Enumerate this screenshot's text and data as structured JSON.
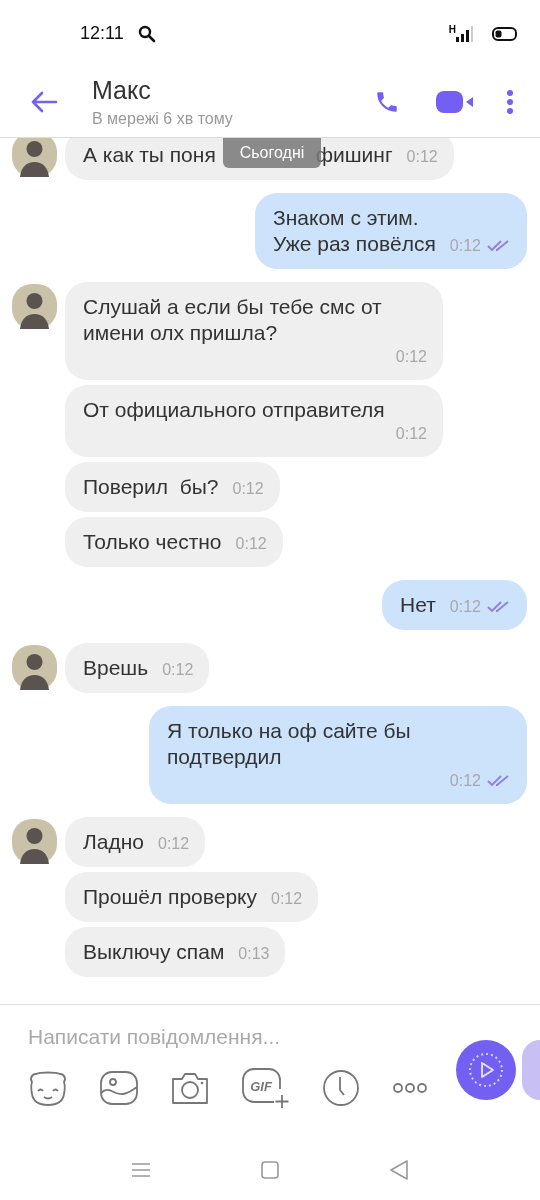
{
  "status_bar": {
    "time": "12:11",
    "network": "H"
  },
  "header": {
    "name": "Макс",
    "status": "В мережі 6 хв тому"
  },
  "date_pill": "Сьогодні",
  "groups": [
    {
      "kind": "incoming",
      "messages": [
        {
          "parts": [
            "А как ты поня",
            "фишинг"
          ],
          "time": "0:12"
        }
      ]
    },
    {
      "kind": "outgoing",
      "messages": [
        {
          "text": "Знаком с этим.\nУже раз повёлся",
          "time": "0:12",
          "seen": true
        }
      ]
    },
    {
      "kind": "incoming",
      "messages": [
        {
          "text": "Слушай а если бы тебе смс от имени олх пришла?",
          "time": "0:12"
        },
        {
          "text": "От официального отправителя",
          "time": "0:12"
        },
        {
          "text": "Поверил  бы?",
          "time": "0:12"
        },
        {
          "text": "Только честно",
          "time": "0:12"
        }
      ]
    },
    {
      "kind": "outgoing",
      "messages": [
        {
          "text": "Нет",
          "time": "0:12",
          "seen": true
        }
      ]
    },
    {
      "kind": "incoming",
      "messages": [
        {
          "text": "Врешь",
          "time": "0:12"
        }
      ]
    },
    {
      "kind": "outgoing",
      "messages": [
        {
          "text": "Я только на оф сайте бы подтвердил",
          "time": "0:12",
          "seen": true
        }
      ]
    },
    {
      "kind": "incoming",
      "messages": [
        {
          "text": "Ладно",
          "time": "0:12"
        },
        {
          "text": "Прошёл проверку",
          "time": "0:12"
        },
        {
          "text": "Выключу спам",
          "time": "0:13"
        }
      ]
    }
  ],
  "composer": {
    "placeholder": "Написати повідомлення...",
    "tools": [
      {
        "kind": "sticker"
      },
      {
        "kind": "gallery"
      },
      {
        "kind": "camera"
      },
      {
        "kind": "gif",
        "label": "GIF"
      },
      {
        "kind": "clock"
      },
      {
        "kind": "more"
      }
    ]
  }
}
